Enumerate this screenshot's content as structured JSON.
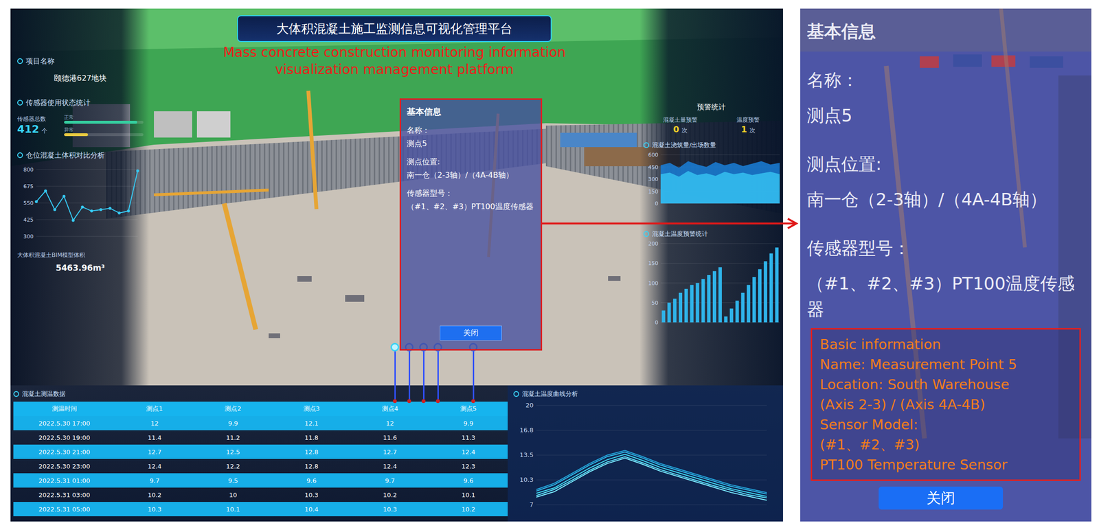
{
  "header": {
    "title": "大体积混凝土施工监测信息可视化管理平台",
    "annotation": "Mass concrete construction monitoring information visualization management platform"
  },
  "left_panel": {
    "project_label": "项目名称",
    "project_name": "颐德港627地块",
    "sensor_title": "传感器使用状态统计",
    "sensor_total_label": "传感器总数",
    "sensor_total": "412",
    "sensor_unit": "个",
    "sensor_bars": [
      {
        "label": "正常",
        "level": 0.92,
        "color": "#35d0a0"
      },
      {
        "label": "异常",
        "level": 0.3,
        "color": "#e6c840"
      }
    ],
    "volume_chart": {
      "title": "仓位混凝土体积对比分析",
      "ticks": [
        "800",
        "675",
        "550",
        "425",
        "300"
      ],
      "values": [
        560,
        640,
        500,
        600,
        420,
        520,
        490,
        500,
        510,
        475,
        490,
        790
      ]
    },
    "bim_label": "大体积混凝土BIM模型体积",
    "bim_value": "5463.96m³"
  },
  "warning": {
    "title": "预警统计",
    "items": [
      {
        "label": "混凝土量预警",
        "count": "0",
        "unit": "次"
      },
      {
        "label": "温度预警",
        "count": "1",
        "unit": "次"
      }
    ]
  },
  "area_chart": {
    "title": "混凝土浇筑量/出场数量",
    "ticks": [
      "600",
      "450",
      "300",
      "150",
      "0"
    ],
    "series": [
      {
        "values": [
          470,
          500,
          440,
          520,
          480,
          450,
          510,
          470,
          500,
          460,
          490,
          520,
          480,
          500
        ],
        "color": "#1a7fd8"
      },
      {
        "values": [
          360,
          380,
          330,
          400,
          350,
          370,
          340,
          390,
          360,
          380,
          350,
          370,
          390,
          360
        ],
        "color": "#35c0f0"
      }
    ]
  },
  "bar_chart": {
    "title": "混凝土温度预警统计",
    "ticks": [
      "200",
      "150",
      "100",
      "50",
      "0"
    ],
    "values": [
      30,
      50,
      60,
      75,
      85,
      95,
      100,
      110,
      120,
      130,
      140,
      15,
      35,
      55,
      75,
      95,
      115,
      135,
      155,
      175,
      190
    ]
  },
  "popup": {
    "title": "基本信息",
    "fields": [
      {
        "label": "名称：",
        "value": "测点5"
      },
      {
        "label": "测点位置:",
        "value": "南一仓（2-3轴）/（4A-4B轴）"
      },
      {
        "label": "传感器型号：",
        "value": "（#1、#2、#3）PT100温度传感器"
      }
    ],
    "close": "关闭"
  },
  "pins": [
    {
      "selected": true
    },
    {
      "selected": false
    },
    {
      "selected": false
    },
    {
      "selected": false
    },
    {
      "selected": false
    }
  ],
  "table": {
    "title": "混凝土测温数据",
    "columns": [
      "测温时间",
      "测点1",
      "测点2",
      "测点3",
      "测点4",
      "测点5"
    ],
    "rows": [
      [
        "2022.5.30 17:00",
        "12",
        "9.9",
        "12.1",
        "12",
        "9.9"
      ],
      [
        "2022.5.30 19:00",
        "11.4",
        "11.2",
        "11.8",
        "11.6",
        "11.3"
      ],
      [
        "2022.5.30 21:00",
        "12.7",
        "12.5",
        "12.8",
        "12.7",
        "12.4"
      ],
      [
        "2022.5.30 23:00",
        "12.4",
        "12.2",
        "12.8",
        "12.4",
        "12.3"
      ],
      [
        "2022.5.31 01:00",
        "9.7",
        "9.5",
        "9.6",
        "9.7",
        "9.6"
      ],
      [
        "2022.5.31 03:00",
        "10.2",
        "10",
        "10.3",
        "10.2",
        "10.1"
      ],
      [
        "2022.5.31 05:00",
        "10.3",
        "10.1",
        "10.4",
        "10.3",
        "10.2"
      ]
    ]
  },
  "temp_chart": {
    "title": "混凝土温度曲线分析",
    "ticks": [
      "20",
      "16.8",
      "13.5",
      "10.3",
      "7"
    ],
    "series": [
      {
        "values": [
          8.5,
          9.2,
          10.5,
          11.8,
          12.9,
          13.6,
          12.8,
          11.9,
          11.2,
          10.5,
          9.8,
          9.1,
          8.6,
          8.1
        ],
        "color": "#3fd8f0"
      },
      {
        "values": [
          8.8,
          9.6,
          10.9,
          12.2,
          13.3,
          13.9,
          13.1,
          12.2,
          11.5,
          10.8,
          10.1,
          9.4,
          8.9,
          8.4
        ],
        "color": "#2fb8e8"
      },
      {
        "values": [
          8.2,
          9.0,
          10.2,
          11.5,
          12.6,
          13.3,
          12.5,
          11.6,
          10.9,
          10.2,
          9.5,
          8.9,
          8.3,
          7.9
        ],
        "color": "#5ae0f8"
      },
      {
        "values": [
          9.0,
          9.8,
          11.1,
          12.4,
          13.5,
          14.1,
          13.3,
          12.4,
          11.7,
          11.0,
          10.3,
          9.6,
          9.1,
          8.6
        ],
        "color": "#22a0d8"
      },
      {
        "values": [
          8.0,
          8.7,
          10.0,
          11.3,
          12.4,
          13.1,
          12.3,
          11.4,
          10.7,
          10.0,
          9.3,
          8.6,
          8.1,
          7.6
        ],
        "color": "#7aeaff"
      }
    ]
  },
  "zoom": {
    "annotation": [
      "Basic information",
      "Name: Measurement Point 5",
      "Location: South Warehouse",
      "(Axis 2-3) / (Axis 4A-4B)",
      "Sensor Model:",
      "(#1、#2、#3)",
      "PT100 Temperature Sensor"
    ]
  }
}
